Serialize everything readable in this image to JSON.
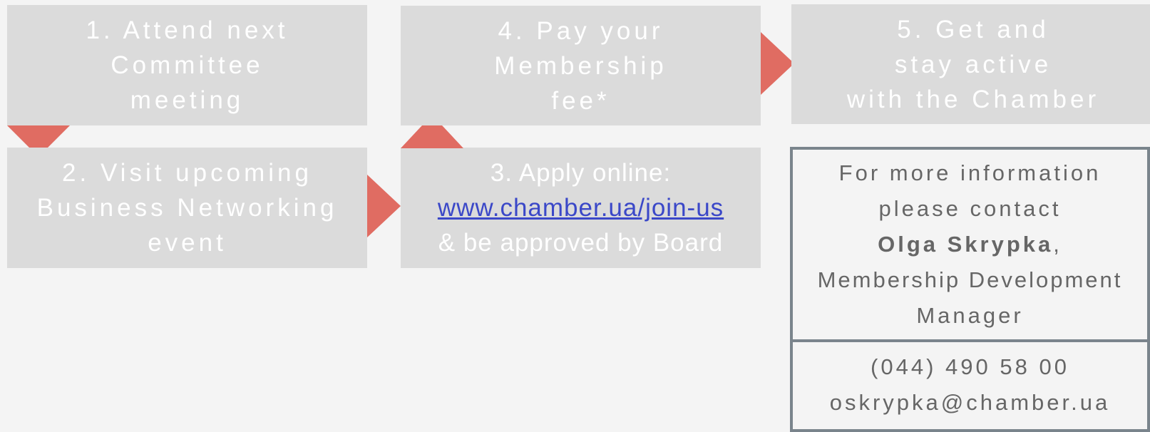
{
  "steps": {
    "step1": {
      "lines": [
        "1.  Attend next",
        "Committee",
        "meeting"
      ]
    },
    "step2": {
      "lines": [
        "2. Visit upcoming",
        "Business Networking",
        "event"
      ]
    },
    "step3": {
      "line1": "3. Apply online:",
      "link": "www.chamber.ua/join-us",
      "line3": "& be approved by Board"
    },
    "step4": {
      "lines": [
        "4. Pay your",
        "Membership",
        "fee*"
      ]
    },
    "step5": {
      "lines": [
        "5. Get and",
        "stay active",
        "with the Chamber"
      ]
    }
  },
  "contact": {
    "line1": "For more information",
    "line2": "please contact",
    "name": "Olga Skrypka",
    "name_suffix": ",",
    "role_line1": "Membership Development",
    "role_line2": "Manager",
    "phone": "(044) 490 58 00",
    "email": "oskrypka@chamber.ua"
  },
  "colors": {
    "box": "#dbdbdb",
    "arrow": "#e06c62",
    "link": "#3b48c8",
    "border": "#7a848c"
  }
}
